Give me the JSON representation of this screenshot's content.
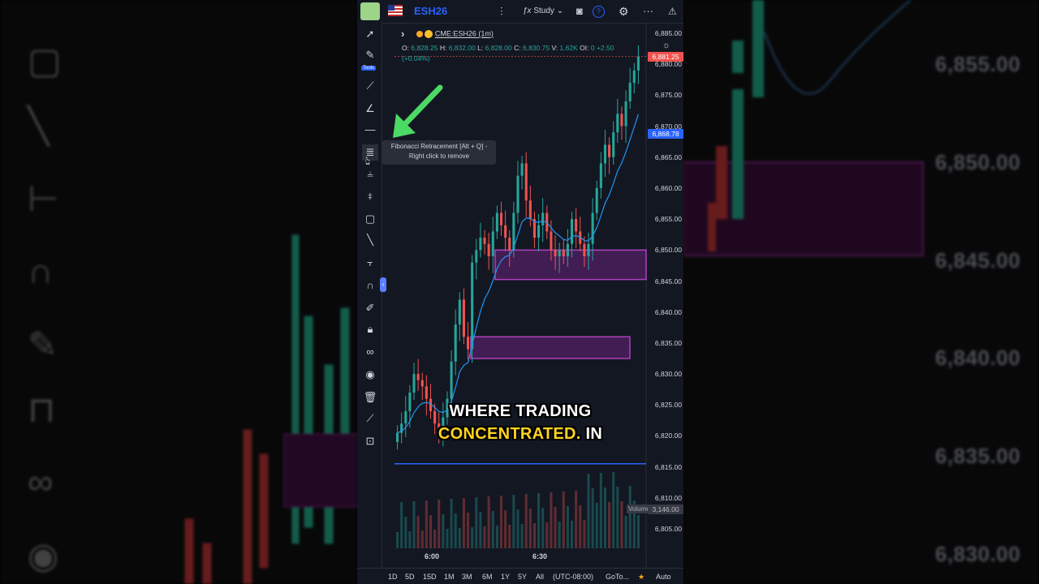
{
  "background": {
    "right_prices": [
      "6,855.00",
      "6,850.00",
      "6,845.00",
      "6,840.00",
      "6,835.00",
      "6,830.00"
    ]
  },
  "topbar": {
    "symbol": "ESH26",
    "study_label": "Study",
    "help_icon": "?"
  },
  "legend": {
    "symbol_line": "CME:ESH26 (1m)",
    "ohlc": {
      "o_label": "O:",
      "o": "6,828.25",
      "h_label": "H:",
      "h": "6,832.00",
      "l_label": "L:",
      "l": "6,828.00",
      "c_label": "C:",
      "c": "6,830.75",
      "v_label": "V:",
      "v": "1.62K",
      "oi_label": "OI:",
      "oi": "0",
      "chg": "+2.50"
    },
    "chg_pct": "(+0.04%)"
  },
  "toolbar": {
    "tools_badge": "Tools"
  },
  "tooltip": {
    "line1": "Fibonacci Retracement [Alt + Q] -",
    "line2": "Right click to remove"
  },
  "y_axis": [
    "6,885.00",
    "6,880.00",
    "6,875.00",
    "6,870.00",
    "6,865.00",
    "6,860.00",
    "6,855.00",
    "6,850.00",
    "6,845.00",
    "6,840.00",
    "6,835.00",
    "6,830.00",
    "6,825.00",
    "6,820.00",
    "6,815.00",
    "6,810.00",
    "6,805.00"
  ],
  "price_tags": {
    "last": "6,881.25",
    "ma": "6,868.78",
    "volume_label": "Volume",
    "volume_value": "3,146.00"
  },
  "x_axis": [
    "6:00",
    "6:30"
  ],
  "bottombar": {
    "ranges": [
      "1D",
      "5D",
      "15D",
      "1M",
      "3M",
      "6M",
      "1Y",
      "5Y",
      "All"
    ],
    "timezone": "(UTC-08:00)",
    "goto": "GoTo...",
    "auto": "Auto"
  },
  "caption": {
    "line1": "WHERE TRADING",
    "line2_yellow": "CONCENTRATED.",
    "line2_white": " IN"
  },
  "colors": {
    "up": "#26a69a",
    "down": "#ef5350",
    "zone": "#9c27b0",
    "ma_line": "#2196f3",
    "accent": "#2962ff",
    "caption_yellow": "#ffd21f"
  },
  "chart_data": {
    "type": "candlestick",
    "symbol": "CME:ESH26",
    "interval": "1m",
    "ylim": [
      6802,
      6887
    ],
    "x_ticks": [
      "6:00",
      "6:30"
    ],
    "closes": [
      6820.5,
      6822,
      6824,
      6827,
      6830,
      6829,
      6828,
      6826,
      6824,
      6822,
      6821,
      6823,
      6826,
      6832,
      6838,
      6842,
      6836,
      6834,
      6848,
      6850,
      6852,
      6851,
      6849,
      6853,
      6856,
      6854,
      6852,
      6850,
      6856,
      6862,
      6864,
      6858,
      6855,
      6852,
      6854,
      6856,
      6853,
      6850,
      6849,
      6850,
      6849,
      6851,
      6855,
      6853,
      6851,
      6849,
      6851,
      6856,
      6860,
      6864,
      6867,
      6865,
      6869,
      6872,
      6870,
      6874,
      6877,
      6879,
      6881.25
    ],
    "moving_average": {
      "last": 6868.78
    },
    "zones": [
      {
        "low": 6845.25,
        "high": 6850.0
      },
      {
        "low": 6832.5,
        "high": 6836.0
      }
    ],
    "horizontal_line": 6815.5,
    "last_price": 6881.25,
    "last_volume": 3146.0
  }
}
